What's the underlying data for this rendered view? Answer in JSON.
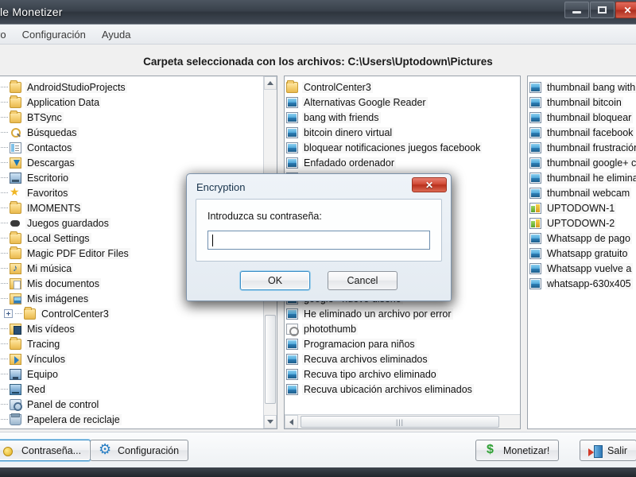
{
  "window": {
    "title": "le Monetizer",
    "buttons": {
      "minimize": "minimize-icon",
      "maximize": "maximize-icon",
      "close": "close-icon"
    }
  },
  "menu": {
    "items": [
      {
        "label": "ivo"
      },
      {
        "label": "Configuración"
      },
      {
        "label": "Ayuda"
      }
    ]
  },
  "header": {
    "headline": "Carpeta seleccionada con los archivos: C:\\Users\\Uptodown\\Pictures"
  },
  "tree": {
    "items": [
      {
        "label": "AndroidStudioProjects",
        "expander": "plus",
        "icon": "folder-icon",
        "depth": 1
      },
      {
        "label": "Application Data",
        "expander": "plus",
        "icon": "folder-icon",
        "depth": 1
      },
      {
        "label": "BTSync",
        "expander": "none",
        "icon": "folder-icon",
        "depth": 1
      },
      {
        "label": "Búsquedas",
        "expander": "none",
        "icon": "search-folder-icon",
        "depth": 1
      },
      {
        "label": "Contactos",
        "expander": "none",
        "icon": "contacts-folder-icon",
        "depth": 1
      },
      {
        "label": "Descargas",
        "expander": "none",
        "icon": "downloads-folder-icon",
        "depth": 1
      },
      {
        "label": "Escritorio",
        "expander": "none",
        "icon": "desktop-folder-icon",
        "depth": 1
      },
      {
        "label": "Favoritos",
        "expander": "plus",
        "icon": "favorites-star-icon",
        "depth": 1
      },
      {
        "label": "IMOMENTS",
        "expander": "plus",
        "icon": "folder-icon",
        "depth": 1
      },
      {
        "label": "Juegos guardados",
        "expander": "none",
        "icon": "saved-games-icon",
        "depth": 1
      },
      {
        "label": "Local Settings",
        "expander": "plus",
        "icon": "folder-icon",
        "depth": 1
      },
      {
        "label": "Magic PDF Editor Files",
        "expander": "plus",
        "icon": "folder-icon",
        "depth": 1
      },
      {
        "label": "Mi música",
        "expander": "plus",
        "icon": "music-folder-icon",
        "depth": 1
      },
      {
        "label": "Mis documentos",
        "expander": "plus",
        "icon": "documents-folder-icon",
        "depth": 1
      },
      {
        "label": "Mis imágenes",
        "expander": "minus",
        "icon": "pictures-folder-icon",
        "depth": 1
      },
      {
        "label": "ControlCenter3",
        "expander": "plus",
        "icon": "folder-icon",
        "depth": 2
      },
      {
        "label": "Mis vídeos",
        "expander": "none",
        "icon": "videos-folder-icon",
        "depth": 1
      },
      {
        "label": "Tracing",
        "expander": "plus",
        "icon": "folder-icon",
        "depth": 1
      },
      {
        "label": "Vínculos",
        "expander": "none",
        "icon": "links-folder-icon",
        "depth": 1
      },
      {
        "label": "Equipo",
        "expander": "none",
        "icon": "computer-icon",
        "depth": 0
      },
      {
        "label": "Red",
        "expander": "none",
        "icon": "network-icon",
        "depth": 0
      },
      {
        "label": "Panel de control",
        "expander": "none",
        "icon": "control-panel-icon",
        "depth": 0
      },
      {
        "label": "Papelera de reciclaje",
        "expander": "none",
        "icon": "recycle-bin-icon",
        "depth": 0
      }
    ]
  },
  "files_middle": {
    "items": [
      {
        "label": "ControlCenter3",
        "icon": "folder-icon"
      },
      {
        "label": "Alternativas Google Reader",
        "icon": "image-icon"
      },
      {
        "label": "bang with friends",
        "icon": "image-icon"
      },
      {
        "label": "bitcoin dinero virtual",
        "icon": "image-icon"
      },
      {
        "label": "bloquear notificaciones juegos facebook",
        "icon": "image-icon"
      },
      {
        "label": "Enfadado ordenador",
        "icon": "image-icon"
      },
      {
        "label": "",
        "icon": "image-icon"
      },
      {
        "label": "",
        "icon": "image-icon"
      },
      {
        "label": "",
        "icon": "image-icon"
      },
      {
        "label": "",
        "icon": "image-icon"
      },
      {
        "label": "",
        "icon": "image-icon"
      },
      {
        "label": "",
        "icon": "image-icon"
      },
      {
        "label": "",
        "icon": "image-icon"
      },
      {
        "label": "",
        "icon": "image-icon"
      },
      {
        "label": "google+ nuevo diseño",
        "icon": "image-icon"
      },
      {
        "label": "He eliminado un archivo por error",
        "icon": "image-icon"
      },
      {
        "label": "photothumb",
        "icon": "thumb-icon"
      },
      {
        "label": "Programacion para niños",
        "icon": "image-icon"
      },
      {
        "label": "Recuva archivos eliminados",
        "icon": "image-icon"
      },
      {
        "label": "Recuva tipo archivo eliminado",
        "icon": "image-icon"
      },
      {
        "label": "Recuva ubicación archivos eliminados",
        "icon": "image-icon"
      }
    ]
  },
  "files_right": {
    "items": [
      {
        "label": "thumbnail bang with",
        "icon": "image-icon"
      },
      {
        "label": "thumbnail bitcoin",
        "icon": "image-icon"
      },
      {
        "label": "thumbnail bloquear",
        "icon": "image-icon"
      },
      {
        "label": "thumbnail facebook",
        "icon": "image-icon"
      },
      {
        "label": "thumbnail frustración",
        "icon": "image-icon"
      },
      {
        "label": "thumbnail google+ c",
        "icon": "image-icon"
      },
      {
        "label": "thumbnail he elimina",
        "icon": "image-icon"
      },
      {
        "label": "thumbnail webcam",
        "icon": "image-icon"
      },
      {
        "label": "UPTODOWN-1",
        "icon": "chart-image-icon"
      },
      {
        "label": "UPTODOWN-2",
        "icon": "chart-image-icon"
      },
      {
        "label": "Whatsapp de pago",
        "icon": "image-icon"
      },
      {
        "label": "Whatsapp gratuito",
        "icon": "image-icon"
      },
      {
        "label": "Whatsapp vuelve a",
        "icon": "image-icon"
      },
      {
        "label": "whatsapp-630x405",
        "icon": "image-icon"
      }
    ]
  },
  "toolbar": {
    "password_label": "Contraseña...",
    "settings_label": "Configuración",
    "monetize_label": "Monetizar!",
    "exit_label": "Salir"
  },
  "dialog": {
    "title": "Encryption",
    "close_glyph": "✕",
    "prompt": "Introduzca su contraseña:",
    "input_value": "",
    "input_placeholder": "",
    "ok_label": "OK",
    "cancel_label": "Cancel"
  },
  "colors": {
    "titlebar": "#39414b",
    "accent_focus": "#3d8fc6",
    "close_red": "#c9412f",
    "folder_yellow": "#e8b94e",
    "money_green": "#2f9e35"
  }
}
